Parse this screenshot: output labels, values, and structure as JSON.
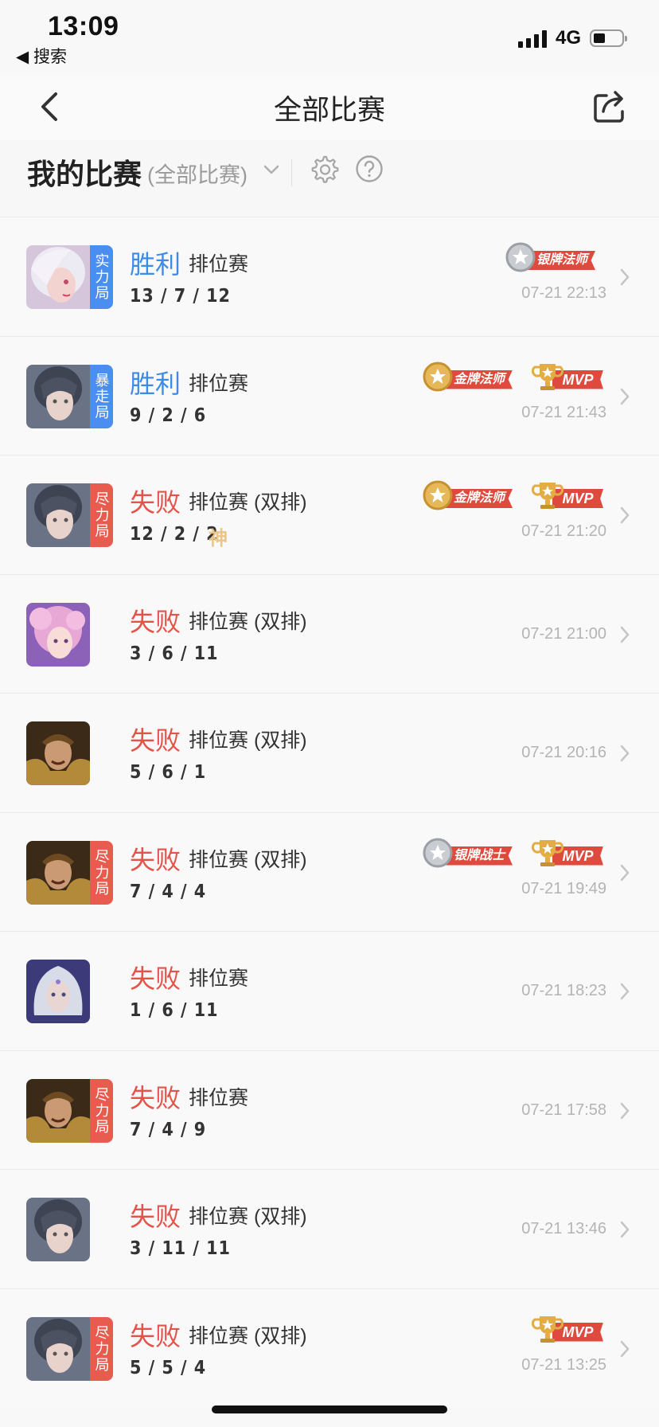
{
  "status_bar": {
    "time": "13:09",
    "back_app": "◀ 搜索",
    "network": "4G"
  },
  "nav": {
    "title": "全部比赛"
  },
  "section": {
    "title": "我的比赛",
    "filter": "(全部比赛)"
  },
  "colors": {
    "win": "#3e8be7",
    "loss": "#e4534a",
    "tag_blue": "#4a8ef0",
    "tag_red": "#e85c4f",
    "ribbon_red": "#de4b3e",
    "gold": "#d9a23a"
  },
  "matches": [
    {
      "result": "胜利",
      "mode": "排位赛",
      "kda": "13 / 7 / 12",
      "date": "07-21 22:13",
      "tag": "实力局",
      "badges": [
        {
          "type": "silver",
          "label": "银牌法师"
        }
      ]
    },
    {
      "result": "胜利",
      "mode": "排位赛",
      "kda": "9 / 2 / 6",
      "date": "07-21 21:43",
      "tag": "暴走局",
      "badges": [
        {
          "type": "gold",
          "label": "金牌法师"
        },
        {
          "type": "mvp",
          "label": "MVP"
        }
      ]
    },
    {
      "result": "失败",
      "mode": "排位赛 (双排)",
      "kda": "12 / 2 / 2",
      "extra": "神",
      "date": "07-21 21:20",
      "tag": "尽力局",
      "badges": [
        {
          "type": "gold",
          "label": "金牌法师"
        },
        {
          "type": "mvp",
          "label": "MVP"
        }
      ]
    },
    {
      "result": "失败",
      "mode": "排位赛 (双排)",
      "kda": "3 / 6 / 11",
      "date": "07-21 21:00"
    },
    {
      "result": "失败",
      "mode": "排位赛 (双排)",
      "kda": "5 / 6 / 1",
      "date": "07-21 20:16"
    },
    {
      "result": "失败",
      "mode": "排位赛 (双排)",
      "kda": "7 / 4 / 4",
      "date": "07-21 19:49",
      "tag": "尽力局",
      "badges": [
        {
          "type": "silver",
          "label": "银牌战士"
        },
        {
          "type": "mvp",
          "label": "MVP"
        }
      ]
    },
    {
      "result": "失败",
      "mode": "排位赛",
      "kda": "1 / 6 / 11",
      "date": "07-21 18:23"
    },
    {
      "result": "失败",
      "mode": "排位赛",
      "kda": "7 / 4 / 9",
      "date": "07-21 17:58",
      "tag": "尽力局"
    },
    {
      "result": "失败",
      "mode": "排位赛 (双排)",
      "kda": "3 / 11 / 11",
      "date": "07-21 13:46"
    },
    {
      "result": "失败",
      "mode": "排位赛 (双排)",
      "kda": "5 / 5 / 4",
      "date": "07-21 13:25",
      "tag": "尽力局",
      "badges": [
        {
          "type": "mvp",
          "label": "MVP"
        }
      ]
    }
  ]
}
